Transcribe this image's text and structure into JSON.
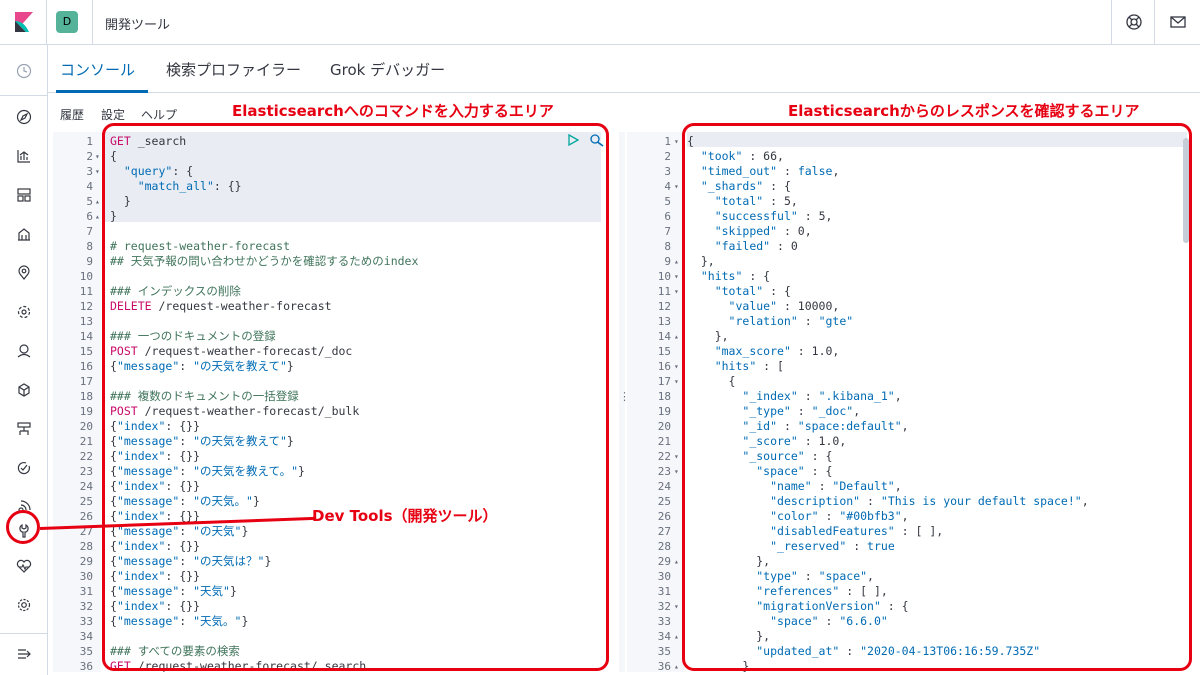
{
  "header": {
    "space_initial": "D",
    "app_title": "開発ツール",
    "icons": [
      "kibana-logo-icon",
      "help-lifebuoy-icon",
      "newsfeed-mail-icon"
    ]
  },
  "tabs": [
    {
      "label": "コンソール",
      "active": true
    },
    {
      "label": "検索プロファイラー",
      "active": false
    },
    {
      "label": "Grok デバッガー",
      "active": false
    }
  ],
  "console_menu": {
    "history": "履歴",
    "settings": "設定",
    "help": "ヘルプ"
  },
  "annotations": {
    "input_area": "Elasticsearchへのコマンドを入力するエリア",
    "output_area": "Elasticsearchからのレスポンスを確認するエリア",
    "dev_tools": "Dev Tools（開発ツール）"
  },
  "colors": {
    "accent": "#006bb4",
    "annotation_red": "#e60012",
    "method": "#c80a68",
    "comment": "#41755c",
    "space_badge": "#54b399"
  },
  "nav_icons": [
    "recent-clock-icon",
    "discover-compass-icon",
    "visualize-chart-icon",
    "dashboard-icon",
    "canvas-icon",
    "maps-icon",
    "ml-icon",
    "infrastructure-icon",
    "logs-icon",
    "apm-icon",
    "uptime-icon",
    "siem-icon",
    "dev-tools-wrench-icon",
    "monitoring-heartbeat-icon",
    "management-gear-icon",
    "collapse-menu-icon"
  ],
  "request_lines": [
    {
      "n": "1",
      "fold": "",
      "parts": [
        [
          "m",
          "GET"
        ],
        [
          "t",
          " _search"
        ]
      ]
    },
    {
      "n": "2",
      "fold": "▾",
      "parts": [
        [
          "t",
          "{"
        ]
      ]
    },
    {
      "n": "3",
      "fold": "▾",
      "parts": [
        [
          "t",
          "  "
        ],
        [
          "s",
          "\"query\""
        ],
        [
          "t",
          ": {"
        ]
      ]
    },
    {
      "n": "4",
      "fold": "",
      "parts": [
        [
          "t",
          "    "
        ],
        [
          "s",
          "\"match_all\""
        ],
        [
          "t",
          ": {}"
        ]
      ]
    },
    {
      "n": "5",
      "fold": "▴",
      "parts": [
        [
          "t",
          "  }"
        ]
      ]
    },
    {
      "n": "6",
      "fold": "▴",
      "parts": [
        [
          "t",
          "}"
        ]
      ]
    },
    {
      "n": "7",
      "fold": "",
      "parts": []
    },
    {
      "n": "8",
      "fold": "",
      "parts": [
        [
          "c",
          "# request-weather-forecast"
        ]
      ]
    },
    {
      "n": "9",
      "fold": "",
      "parts": [
        [
          "c",
          "## 天気予報の問い合わせかどうかを確認するためのindex"
        ]
      ]
    },
    {
      "n": "10",
      "fold": "",
      "parts": []
    },
    {
      "n": "11",
      "fold": "",
      "parts": [
        [
          "c",
          "### インデックスの削除"
        ]
      ]
    },
    {
      "n": "12",
      "fold": "",
      "parts": [
        [
          "m",
          "DELETE"
        ],
        [
          "t",
          " /request-weather-forecast"
        ]
      ]
    },
    {
      "n": "13",
      "fold": "",
      "parts": []
    },
    {
      "n": "14",
      "fold": "",
      "parts": [
        [
          "c",
          "### 一つのドキュメントの登録"
        ]
      ]
    },
    {
      "n": "15",
      "fold": "",
      "parts": [
        [
          "m",
          "POST"
        ],
        [
          "t",
          " /request-weather-forecast/_doc"
        ]
      ]
    },
    {
      "n": "16",
      "fold": "",
      "parts": [
        [
          "t",
          "{"
        ],
        [
          "s",
          "\"message\""
        ],
        [
          "t",
          ": "
        ],
        [
          "s",
          "\"の天気を教えて\""
        ],
        [
          "t",
          "}"
        ]
      ]
    },
    {
      "n": "17",
      "fold": "",
      "parts": []
    },
    {
      "n": "18",
      "fold": "",
      "parts": [
        [
          "c",
          "### 複数のドキュメントの一括登録"
        ]
      ]
    },
    {
      "n": "19",
      "fold": "",
      "parts": [
        [
          "m",
          "POST"
        ],
        [
          "t",
          " /request-weather-forecast/_bulk"
        ]
      ]
    },
    {
      "n": "20",
      "fold": "",
      "parts": [
        [
          "t",
          "{"
        ],
        [
          "s",
          "\"index\""
        ],
        [
          "t",
          ": {}}"
        ]
      ]
    },
    {
      "n": "21",
      "fold": "",
      "parts": [
        [
          "t",
          "{"
        ],
        [
          "s",
          "\"message\""
        ],
        [
          "t",
          ": "
        ],
        [
          "s",
          "\"の天気を教えて\""
        ],
        [
          "t",
          "}"
        ]
      ]
    },
    {
      "n": "22",
      "fold": "",
      "parts": [
        [
          "t",
          "{"
        ],
        [
          "s",
          "\"index\""
        ],
        [
          "t",
          ": {}}"
        ]
      ]
    },
    {
      "n": "23",
      "fold": "",
      "parts": [
        [
          "t",
          "{"
        ],
        [
          "s",
          "\"message\""
        ],
        [
          "t",
          ": "
        ],
        [
          "s",
          "\"の天気を教えて。\""
        ],
        [
          "t",
          "}"
        ]
      ]
    },
    {
      "n": "24",
      "fold": "",
      "parts": [
        [
          "t",
          "{"
        ],
        [
          "s",
          "\"index\""
        ],
        [
          "t",
          ": {}}"
        ]
      ]
    },
    {
      "n": "25",
      "fold": "",
      "parts": [
        [
          "t",
          "{"
        ],
        [
          "s",
          "\"message\""
        ],
        [
          "t",
          ": "
        ],
        [
          "s",
          "\"の天気。\""
        ],
        [
          "t",
          "}"
        ]
      ]
    },
    {
      "n": "26",
      "fold": "",
      "parts": [
        [
          "t",
          "{"
        ],
        [
          "s",
          "\"index\""
        ],
        [
          "t",
          ": {}}"
        ]
      ]
    },
    {
      "n": "27",
      "fold": "",
      "parts": [
        [
          "t",
          "{"
        ],
        [
          "s",
          "\"message\""
        ],
        [
          "t",
          ": "
        ],
        [
          "s",
          "\"の天気\""
        ],
        [
          "t",
          "}"
        ]
      ]
    },
    {
      "n": "28",
      "fold": "",
      "parts": [
        [
          "t",
          "{"
        ],
        [
          "s",
          "\"index\""
        ],
        [
          "t",
          ": {}}"
        ]
      ]
    },
    {
      "n": "29",
      "fold": "",
      "parts": [
        [
          "t",
          "{"
        ],
        [
          "s",
          "\"message\""
        ],
        [
          "t",
          ": "
        ],
        [
          "s",
          "\"の天気は？\""
        ],
        [
          "t",
          "}"
        ]
      ]
    },
    {
      "n": "30",
      "fold": "",
      "parts": [
        [
          "t",
          "{"
        ],
        [
          "s",
          "\"index\""
        ],
        [
          "t",
          ": {}}"
        ]
      ]
    },
    {
      "n": "31",
      "fold": "",
      "parts": [
        [
          "t",
          "{"
        ],
        [
          "s",
          "\"message\""
        ],
        [
          "t",
          ": "
        ],
        [
          "s",
          "\"天気\""
        ],
        [
          "t",
          "}"
        ]
      ]
    },
    {
      "n": "32",
      "fold": "",
      "parts": [
        [
          "t",
          "{"
        ],
        [
          "s",
          "\"index\""
        ],
        [
          "t",
          ": {}}"
        ]
      ]
    },
    {
      "n": "33",
      "fold": "",
      "parts": [
        [
          "t",
          "{"
        ],
        [
          "s",
          "\"message\""
        ],
        [
          "t",
          ": "
        ],
        [
          "s",
          "\"天気。\""
        ],
        [
          "t",
          "}"
        ]
      ]
    },
    {
      "n": "34",
      "fold": "",
      "parts": []
    },
    {
      "n": "35",
      "fold": "",
      "parts": [
        [
          "c",
          "### すべての要素の検索"
        ]
      ]
    },
    {
      "n": "36",
      "fold": "",
      "parts": [
        [
          "m",
          "GET"
        ],
        [
          "t",
          " /request-weather-forecast/_search"
        ]
      ]
    }
  ],
  "response_lines": [
    {
      "n": "1",
      "fold": "▾",
      "parts": [
        [
          "t",
          "{"
        ]
      ]
    },
    {
      "n": "2",
      "fold": "",
      "parts": [
        [
          "t",
          "  "
        ],
        [
          "s",
          "\"took\""
        ],
        [
          "t",
          " : 66,"
        ]
      ]
    },
    {
      "n": "3",
      "fold": "",
      "parts": [
        [
          "t",
          "  "
        ],
        [
          "s",
          "\"timed_out\""
        ],
        [
          "t",
          " : "
        ],
        [
          "k",
          "false"
        ],
        [
          "t",
          ","
        ]
      ]
    },
    {
      "n": "4",
      "fold": "▾",
      "parts": [
        [
          "t",
          "  "
        ],
        [
          "s",
          "\"_shards\""
        ],
        [
          "t",
          " : {"
        ]
      ]
    },
    {
      "n": "5",
      "fold": "",
      "parts": [
        [
          "t",
          "    "
        ],
        [
          "s",
          "\"total\""
        ],
        [
          "t",
          " : 5,"
        ]
      ]
    },
    {
      "n": "6",
      "fold": "",
      "parts": [
        [
          "t",
          "    "
        ],
        [
          "s",
          "\"successful\""
        ],
        [
          "t",
          " : 5,"
        ]
      ]
    },
    {
      "n": "7",
      "fold": "",
      "parts": [
        [
          "t",
          "    "
        ],
        [
          "s",
          "\"skipped\""
        ],
        [
          "t",
          " : 0,"
        ]
      ]
    },
    {
      "n": "8",
      "fold": "",
      "parts": [
        [
          "t",
          "    "
        ],
        [
          "s",
          "\"failed\""
        ],
        [
          "t",
          " : 0"
        ]
      ]
    },
    {
      "n": "9",
      "fold": "▴",
      "parts": [
        [
          "t",
          "  },"
        ]
      ]
    },
    {
      "n": "10",
      "fold": "▾",
      "parts": [
        [
          "t",
          "  "
        ],
        [
          "s",
          "\"hits\""
        ],
        [
          "t",
          " : {"
        ]
      ]
    },
    {
      "n": "11",
      "fold": "▾",
      "parts": [
        [
          "t",
          "    "
        ],
        [
          "s",
          "\"total\""
        ],
        [
          "t",
          " : {"
        ]
      ]
    },
    {
      "n": "12",
      "fold": "",
      "parts": [
        [
          "t",
          "      "
        ],
        [
          "s",
          "\"value\""
        ],
        [
          "t",
          " : 10000,"
        ]
      ]
    },
    {
      "n": "13",
      "fold": "",
      "parts": [
        [
          "t",
          "      "
        ],
        [
          "s",
          "\"relation\""
        ],
        [
          "t",
          " : "
        ],
        [
          "s",
          "\"gte\""
        ]
      ]
    },
    {
      "n": "14",
      "fold": "▴",
      "parts": [
        [
          "t",
          "    },"
        ]
      ]
    },
    {
      "n": "15",
      "fold": "",
      "parts": [
        [
          "t",
          "    "
        ],
        [
          "s",
          "\"max_score\""
        ],
        [
          "t",
          " : 1.0,"
        ]
      ]
    },
    {
      "n": "16",
      "fold": "▾",
      "parts": [
        [
          "t",
          "    "
        ],
        [
          "s",
          "\"hits\""
        ],
        [
          "t",
          " : ["
        ]
      ]
    },
    {
      "n": "17",
      "fold": "▾",
      "parts": [
        [
          "t",
          "      {"
        ]
      ]
    },
    {
      "n": "18",
      "fold": "",
      "parts": [
        [
          "t",
          "        "
        ],
        [
          "s",
          "\"_index\""
        ],
        [
          "t",
          " : "
        ],
        [
          "s",
          "\".kibana_1\""
        ],
        [
          "t",
          ","
        ]
      ]
    },
    {
      "n": "19",
      "fold": "",
      "parts": [
        [
          "t",
          "        "
        ],
        [
          "s",
          "\"_type\""
        ],
        [
          "t",
          " : "
        ],
        [
          "s",
          "\"_doc\""
        ],
        [
          "t",
          ","
        ]
      ]
    },
    {
      "n": "20",
      "fold": "",
      "parts": [
        [
          "t",
          "        "
        ],
        [
          "s",
          "\"_id\""
        ],
        [
          "t",
          " : "
        ],
        [
          "s",
          "\"space:default\""
        ],
        [
          "t",
          ","
        ]
      ]
    },
    {
      "n": "21",
      "fold": "",
      "parts": [
        [
          "t",
          "        "
        ],
        [
          "s",
          "\"_score\""
        ],
        [
          "t",
          " : 1.0,"
        ]
      ]
    },
    {
      "n": "22",
      "fold": "▾",
      "parts": [
        [
          "t",
          "        "
        ],
        [
          "s",
          "\"_source\""
        ],
        [
          "t",
          " : {"
        ]
      ]
    },
    {
      "n": "23",
      "fold": "▾",
      "parts": [
        [
          "t",
          "          "
        ],
        [
          "s",
          "\"space\""
        ],
        [
          "t",
          " : {"
        ]
      ]
    },
    {
      "n": "24",
      "fold": "",
      "parts": [
        [
          "t",
          "            "
        ],
        [
          "s",
          "\"name\""
        ],
        [
          "t",
          " : "
        ],
        [
          "s",
          "\"Default\""
        ],
        [
          "t",
          ","
        ]
      ]
    },
    {
      "n": "25",
      "fold": "",
      "parts": [
        [
          "t",
          "            "
        ],
        [
          "s",
          "\"description\""
        ],
        [
          "t",
          " : "
        ],
        [
          "s",
          "\"This is your default space!\""
        ],
        [
          "t",
          ","
        ]
      ]
    },
    {
      "n": "26",
      "fold": "",
      "parts": [
        [
          "t",
          "            "
        ],
        [
          "s",
          "\"color\""
        ],
        [
          "t",
          " : "
        ],
        [
          "s",
          "\"#00bfb3\""
        ],
        [
          "t",
          ","
        ]
      ]
    },
    {
      "n": "27",
      "fold": "",
      "parts": [
        [
          "t",
          "            "
        ],
        [
          "s",
          "\"disabledFeatures\""
        ],
        [
          "t",
          " : [ ],"
        ]
      ]
    },
    {
      "n": "28",
      "fold": "",
      "parts": [
        [
          "t",
          "            "
        ],
        [
          "s",
          "\"_reserved\""
        ],
        [
          "t",
          " : "
        ],
        [
          "k",
          "true"
        ]
      ]
    },
    {
      "n": "29",
      "fold": "▴",
      "parts": [
        [
          "t",
          "          },"
        ]
      ]
    },
    {
      "n": "30",
      "fold": "",
      "parts": [
        [
          "t",
          "          "
        ],
        [
          "s",
          "\"type\""
        ],
        [
          "t",
          " : "
        ],
        [
          "s",
          "\"space\""
        ],
        [
          "t",
          ","
        ]
      ]
    },
    {
      "n": "31",
      "fold": "",
      "parts": [
        [
          "t",
          "          "
        ],
        [
          "s",
          "\"references\""
        ],
        [
          "t",
          " : [ ],"
        ]
      ]
    },
    {
      "n": "32",
      "fold": "▾",
      "parts": [
        [
          "t",
          "          "
        ],
        [
          "s",
          "\"migrationVersion\""
        ],
        [
          "t",
          " : {"
        ]
      ]
    },
    {
      "n": "33",
      "fold": "",
      "parts": [
        [
          "t",
          "            "
        ],
        [
          "s",
          "\"space\""
        ],
        [
          "t",
          " : "
        ],
        [
          "s",
          "\"6.6.0\""
        ]
      ]
    },
    {
      "n": "34",
      "fold": "▴",
      "parts": [
        [
          "t",
          "          },"
        ]
      ]
    },
    {
      "n": "35",
      "fold": "",
      "parts": [
        [
          "t",
          "          "
        ],
        [
          "s",
          "\"updated_at\""
        ],
        [
          "t",
          " : "
        ],
        [
          "s",
          "\"2020-04-13T06:16:59.735Z\""
        ]
      ]
    },
    {
      "n": "36",
      "fold": "▴",
      "parts": [
        [
          "t",
          "        }"
        ]
      ]
    }
  ]
}
